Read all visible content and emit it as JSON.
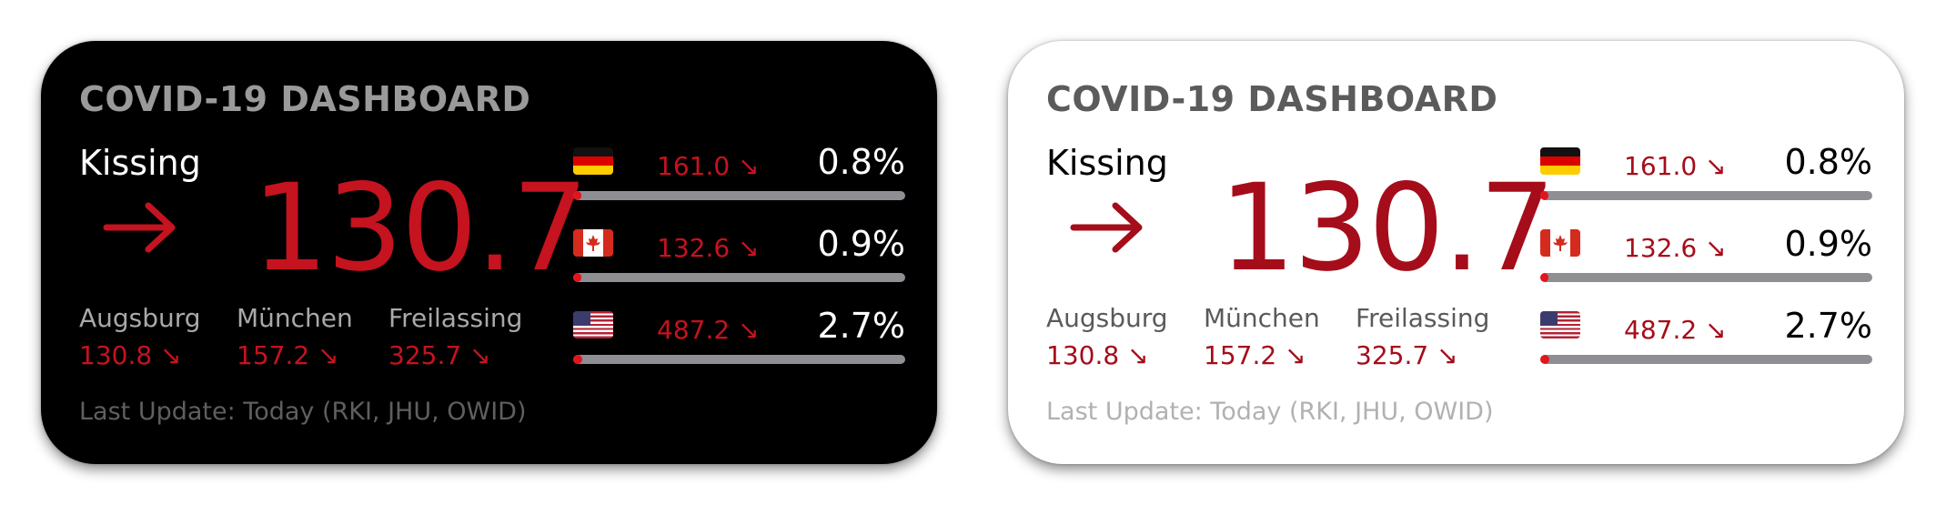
{
  "widgets": [
    {
      "theme": "dark",
      "title": "COVID-19 DASHBOARD",
      "location": "Kissing",
      "trend_icon": "arrow-right-icon",
      "incidence": "130.7",
      "sub_regions": [
        {
          "name": "Augsburg",
          "value": "130.8 ↘"
        },
        {
          "name": "München",
          "value": "157.2 ↘"
        },
        {
          "name": "Freilassing",
          "value": "325.7 ↘"
        }
      ],
      "countries": [
        {
          "flag": "germany-flag-icon",
          "incidence": "161.0 ↘",
          "percent": "0.8%",
          "progress": 0.008
        },
        {
          "flag": "canada-flag-icon",
          "incidence": "132.6 ↘",
          "percent": "0.9%",
          "progress": 0.009
        },
        {
          "flag": "usa-flag-icon",
          "incidence": "487.2 ↘",
          "percent": "2.7%",
          "progress": 0.027
        }
      ],
      "footer": "Last Update: Today (RKI, JHU, OWID)"
    },
    {
      "theme": "light",
      "title": "COVID-19 DASHBOARD",
      "location": "Kissing",
      "trend_icon": "arrow-right-icon",
      "incidence": "130.7",
      "sub_regions": [
        {
          "name": "Augsburg",
          "value": "130.8 ↘"
        },
        {
          "name": "München",
          "value": "157.2 ↘"
        },
        {
          "name": "Freilassing",
          "value": "325.7 ↘"
        }
      ],
      "countries": [
        {
          "flag": "germany-flag-icon",
          "incidence": "161.0 ↘",
          "percent": "0.8%",
          "progress": 0.008
        },
        {
          "flag": "canada-flag-icon",
          "incidence": "132.6 ↘",
          "percent": "0.9%",
          "progress": 0.009
        },
        {
          "flag": "usa-flag-icon",
          "incidence": "487.2 ↘",
          "percent": "2.7%",
          "progress": 0.027
        }
      ],
      "footer": "Last Update: Today (RKI, JHU, OWID)"
    }
  ],
  "colors": {
    "dark_accent": "#c5131f",
    "light_accent": "#a50d1a",
    "bar_track": "#8e8e93",
    "bar_fill": "#e0161f"
  }
}
